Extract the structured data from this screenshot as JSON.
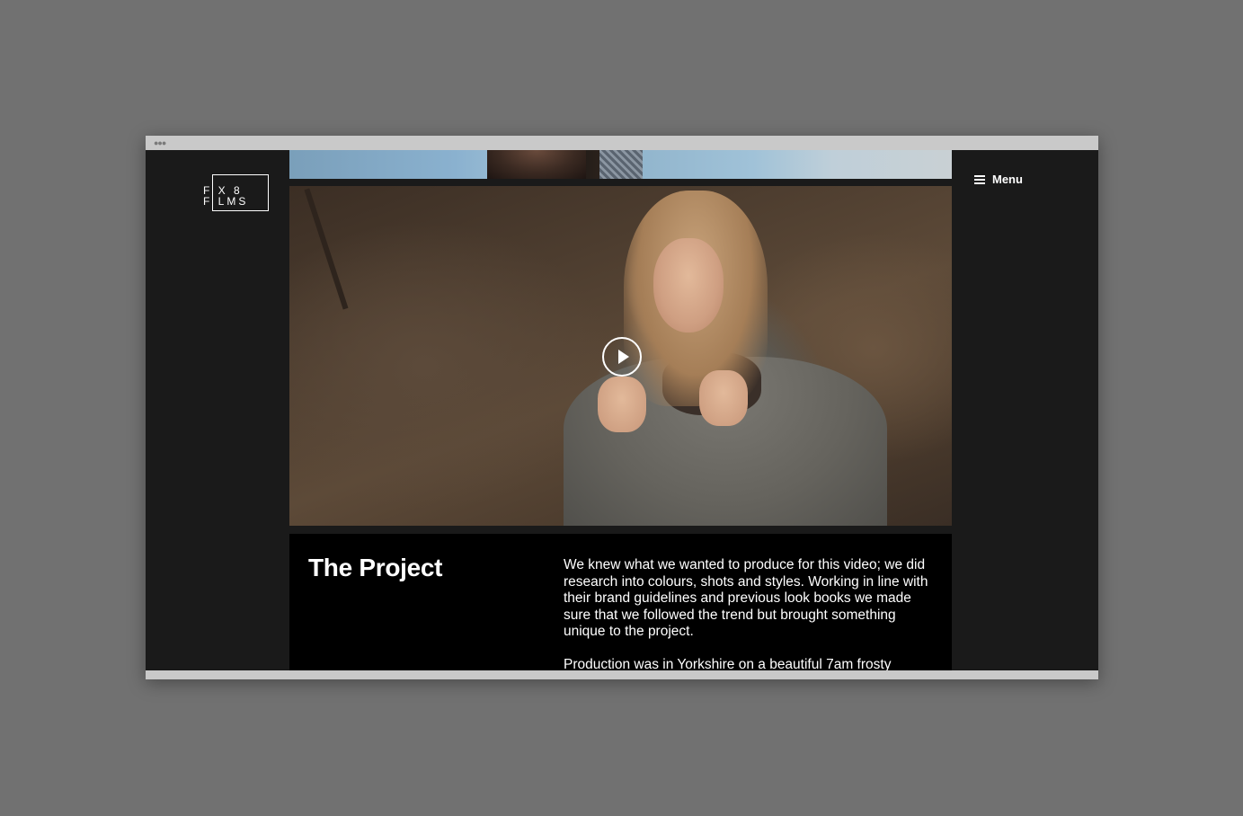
{
  "logo": {
    "line1": "F X 8",
    "line2": "F LMS"
  },
  "menu": {
    "icon": "hamburger-icon",
    "label": "Menu"
  },
  "video": {
    "play_icon": "play-icon"
  },
  "project": {
    "title": "The Project",
    "paragraphs": [
      "We knew what we wanted to produce for this video; we did research into colours, shots and styles. Working in line with their brand guidelines and previous look books we made sure that we followed the trend but brought something unique to the project.",
      "Production was in Yorkshire on a beautiful 7am frosty"
    ]
  },
  "colors": {
    "background": "#717171",
    "site_bg": "#1a1a1a",
    "panel_bg": "#000000",
    "text": "#ffffff"
  }
}
